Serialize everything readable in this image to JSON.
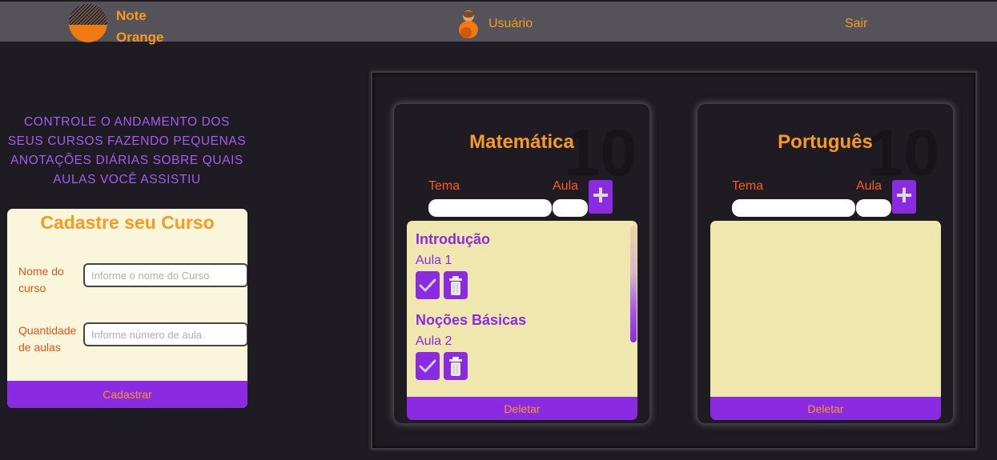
{
  "header": {
    "logo_line1": "Note",
    "logo_line2": "Orange",
    "user_label": "Usuário",
    "logout_label": "Sair"
  },
  "tagline": "CONTROLE O ANDAMENTO DOS SEUS CURSOS FAZENDO PEQUENAS ANOTAÇÕES DIÁRIAS SOBRE QUAIS AULAS VOCÊ ASSISTIU",
  "form": {
    "title": "Cadastre seu Curso",
    "name_label": "Nome do curso",
    "name_placeholder": "Informe o nome do Curso",
    "name_value": "",
    "quantity_label": "Quantidade de aulas",
    "quantity_placeholder": "Informe número de aula",
    "quantity_value": "",
    "submit_label": "Cadastrar"
  },
  "courses": [
    {
      "title": "Matemática",
      "count": "10",
      "tema_label": "Tema",
      "aula_label": "Aula",
      "add_label": "+",
      "lessons": [
        {
          "tema": "Introdução",
          "aula": "Aula 1"
        },
        {
          "tema": "Noções Básicas",
          "aula": "Aula 2"
        }
      ],
      "delete_label": "Deletar"
    },
    {
      "title": "Português",
      "count": "10",
      "tema_label": "Tema",
      "aula_label": "Aula",
      "add_label": "+",
      "lessons": [],
      "delete_label": "Deletar"
    }
  ],
  "icons": {
    "logo": "note-orange-logo-icon",
    "user": "user-avatar-icon",
    "add": "plus-icon",
    "check": "check-icon",
    "trash": "trash-icon"
  },
  "colors": {
    "background": "#1e1b22",
    "header": "#56525a",
    "accent_orange": "#f79a1e",
    "accent_purple": "#8a2be2",
    "label_red": "#ff5a1a",
    "lesson_bg": "#efe7ae",
    "form_bg": "#faf6dc"
  }
}
